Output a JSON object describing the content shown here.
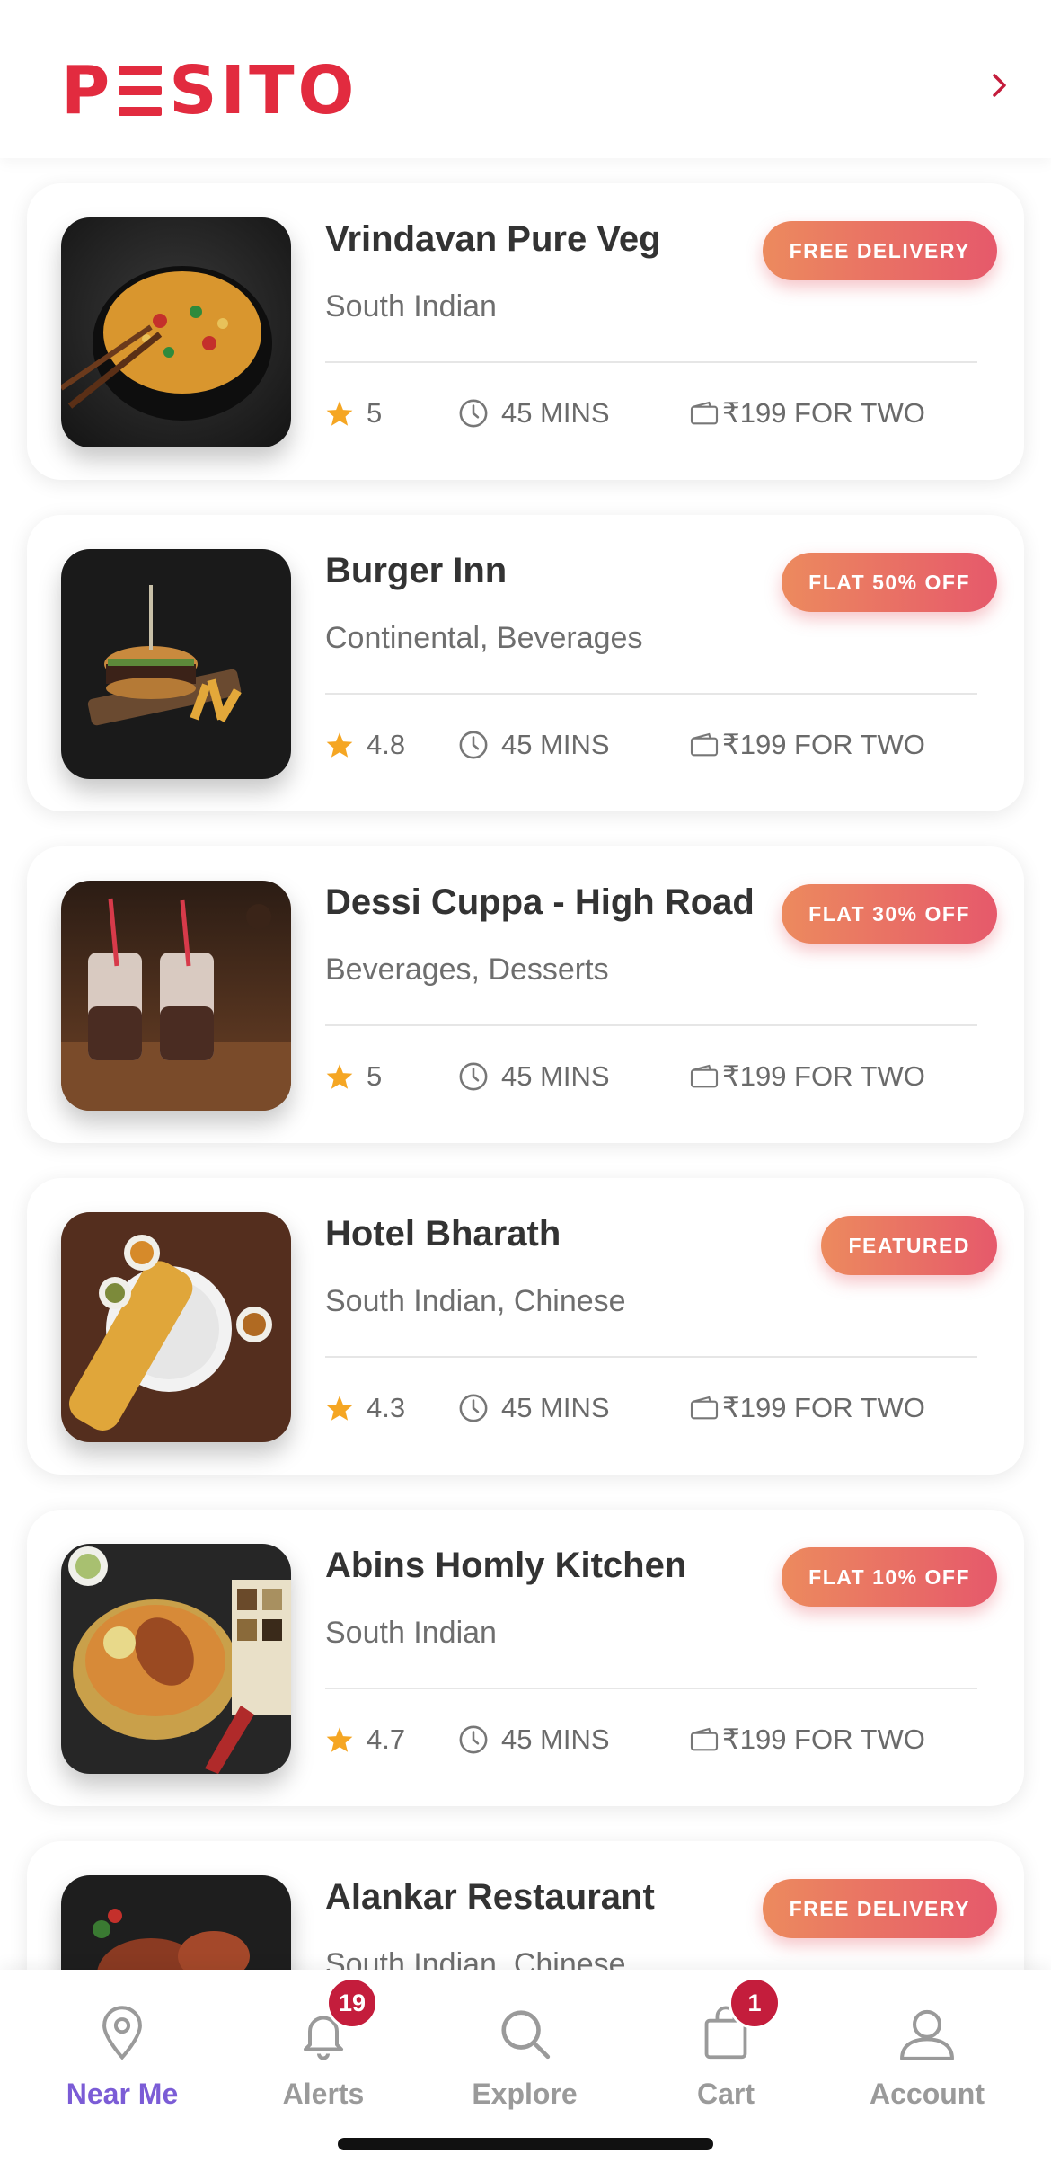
{
  "brand": {
    "logo_text": "PESITO",
    "accent_color": "#e22b3f",
    "tab_active_color": "#7b5cd6",
    "badge_gradient": [
      "#ec8a5e",
      "#e6596b"
    ]
  },
  "header": {
    "next_icon": "chevron-right-icon"
  },
  "restaurants": [
    {
      "name": "Vrindavan Pure Veg",
      "cuisine": "South Indian",
      "badge": "FREE DELIVERY",
      "rating": "5",
      "time": "45 MINS",
      "cost": "₹199 FOR TWO",
      "image": "fried-rice-bowl"
    },
    {
      "name": "Burger Inn",
      "cuisine": "Continental, Beverages",
      "badge": "FLAT 50% OFF",
      "rating": "4.8",
      "time": "45 MINS",
      "cost": "₹199 FOR TWO",
      "image": "burger-and-fries"
    },
    {
      "name": "Dessi Cuppa - High Road",
      "cuisine": "Beverages, Desserts",
      "badge": "FLAT 30% OFF",
      "rating": "5",
      "time": "45 MINS",
      "cost": "₹199 FOR TWO",
      "image": "milkshake-jars"
    },
    {
      "name": "Hotel Bharath",
      "cuisine": "South Indian, Chinese",
      "badge": "FEATURED",
      "rating": "4.3",
      "time": "45 MINS",
      "cost": "₹199 FOR TWO",
      "image": "dosa-plate"
    },
    {
      "name": "Abins Homly Kitchen",
      "cuisine": "South Indian",
      "badge": "FLAT 10% OFF",
      "rating": "4.7",
      "time": "45 MINS",
      "cost": "₹199 FOR TWO",
      "image": "biryani-pot"
    },
    {
      "name": "Alankar Restaurant",
      "cuisine": "South Indian, Chinese",
      "badge": "FREE DELIVERY",
      "rating": "",
      "time": "",
      "cost": "",
      "image": "grilled-chicken"
    }
  ],
  "tabbar": {
    "tabs": [
      {
        "label": "Near Me",
        "icon": "location-pin-icon",
        "active": true
      },
      {
        "label": "Alerts",
        "icon": "bell-icon",
        "badge": "19"
      },
      {
        "label": "Explore",
        "icon": "search-icon"
      },
      {
        "label": "Cart",
        "icon": "shopping-bag-icon",
        "badge": "1"
      },
      {
        "label": "Account",
        "icon": "user-icon"
      }
    ]
  }
}
